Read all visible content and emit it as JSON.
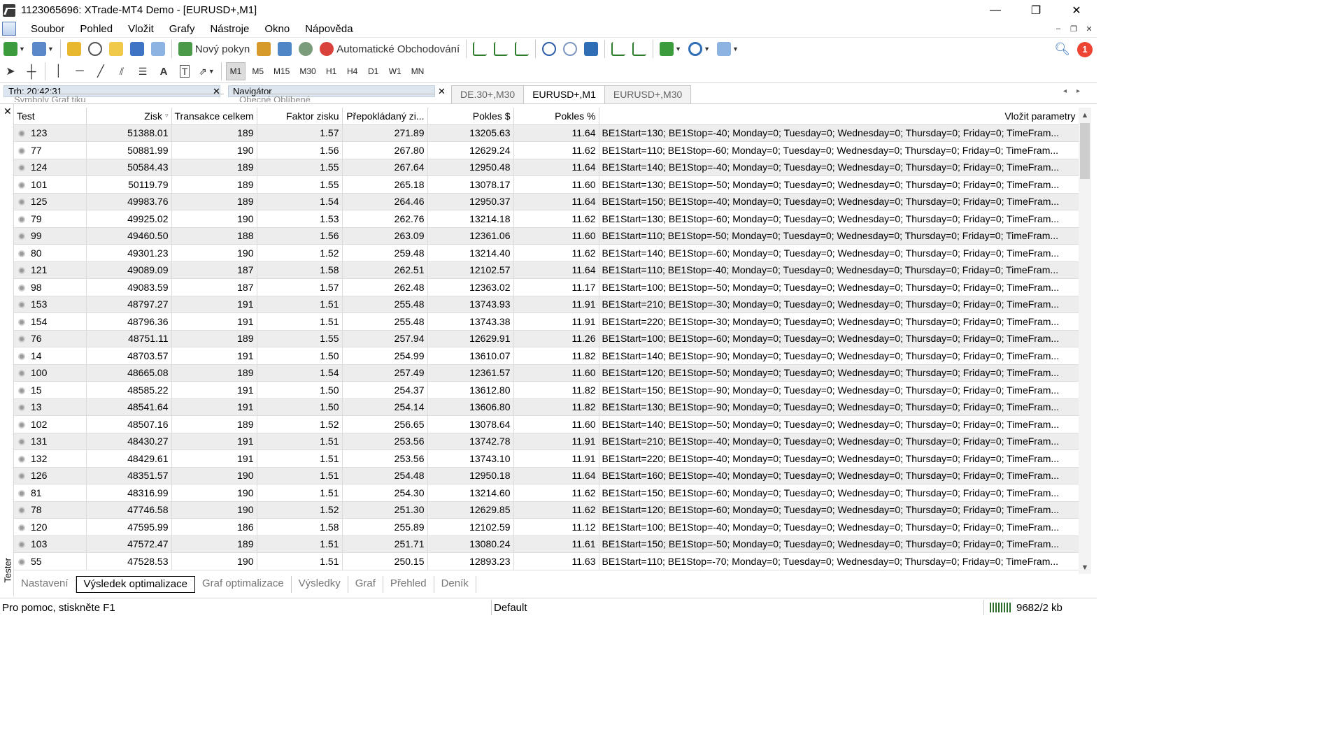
{
  "window": {
    "title": "1123065696: XTrade-MT4 Demo - [EURUSD+,M1]",
    "controls": [
      "—",
      "❐",
      "✕"
    ]
  },
  "menu": [
    "Soubor",
    "Pohled",
    "Vložit",
    "Grafy",
    "Nástroje",
    "Okno",
    "Nápověda"
  ],
  "toolbar": {
    "new_order": "Nový pokyn",
    "auto_trading": "Automatické Obchodování",
    "notification_count": "1"
  },
  "timeframes": [
    "M1",
    "M5",
    "M15",
    "M30",
    "H1",
    "H4",
    "D1",
    "W1",
    "MN"
  ],
  "active_timeframe": "M1",
  "panels": {
    "market_watch": "Trh: 20:42:31",
    "market_watch_tabs": "Symboly   Graf tiku",
    "navigator": "Navigátor",
    "navigator_tabs": "Obecné      Oblíbené"
  },
  "chart_tabs": [
    "DE.30+,M30",
    "EURUSD+,M1",
    "EURUSD+,M30"
  ],
  "active_chart_tab": "EURUSD+,M1",
  "table": {
    "columns": [
      "Test",
      "Zisk",
      "Transakce celkem",
      "Faktor zisku",
      "Přepokládaný zi...",
      "Pokles $",
      "Pokles %",
      "Vložit parametry"
    ],
    "sort_indicator": "▿",
    "param_tail": "; Monday=0; Tuesday=0; Wednesday=0; Thursday=0; Friday=0; TimeFram...",
    "rows": [
      [
        "123",
        "51388.01",
        "189",
        "1.57",
        "271.89",
        "13205.63",
        "11.64",
        "BE1Start=130; BE1Stop=-40"
      ],
      [
        "77",
        "50881.99",
        "190",
        "1.56",
        "267.80",
        "12629.24",
        "11.62",
        "BE1Start=110; BE1Stop=-60"
      ],
      [
        "124",
        "50584.43",
        "189",
        "1.55",
        "267.64",
        "12950.48",
        "11.64",
        "BE1Start=140; BE1Stop=-40"
      ],
      [
        "101",
        "50119.79",
        "189",
        "1.55",
        "265.18",
        "13078.17",
        "11.60",
        "BE1Start=130; BE1Stop=-50"
      ],
      [
        "125",
        "49983.76",
        "189",
        "1.54",
        "264.46",
        "12950.37",
        "11.64",
        "BE1Start=150; BE1Stop=-40"
      ],
      [
        "79",
        "49925.02",
        "190",
        "1.53",
        "262.76",
        "13214.18",
        "11.62",
        "BE1Start=130; BE1Stop=-60"
      ],
      [
        "99",
        "49460.50",
        "188",
        "1.56",
        "263.09",
        "12361.06",
        "11.60",
        "BE1Start=110; BE1Stop=-50"
      ],
      [
        "80",
        "49301.23",
        "190",
        "1.52",
        "259.48",
        "13214.40",
        "11.62",
        "BE1Start=140; BE1Stop=-60"
      ],
      [
        "121",
        "49089.09",
        "187",
        "1.58",
        "262.51",
        "12102.57",
        "11.64",
        "BE1Start=110; BE1Stop=-40"
      ],
      [
        "98",
        "49083.59",
        "187",
        "1.57",
        "262.48",
        "12363.02",
        "11.17",
        "BE1Start=100; BE1Stop=-50"
      ],
      [
        "153",
        "48797.27",
        "191",
        "1.51",
        "255.48",
        "13743.93",
        "11.91",
        "BE1Start=210; BE1Stop=-30"
      ],
      [
        "154",
        "48796.36",
        "191",
        "1.51",
        "255.48",
        "13743.38",
        "11.91",
        "BE1Start=220; BE1Stop=-30"
      ],
      [
        "76",
        "48751.11",
        "189",
        "1.55",
        "257.94",
        "12629.91",
        "11.26",
        "BE1Start=100; BE1Stop=-60"
      ],
      [
        "14",
        "48703.57",
        "191",
        "1.50",
        "254.99",
        "13610.07",
        "11.82",
        "BE1Start=140; BE1Stop=-90"
      ],
      [
        "100",
        "48665.08",
        "189",
        "1.54",
        "257.49",
        "12361.57",
        "11.60",
        "BE1Start=120; BE1Stop=-50"
      ],
      [
        "15",
        "48585.22",
        "191",
        "1.50",
        "254.37",
        "13612.80",
        "11.82",
        "BE1Start=150; BE1Stop=-90"
      ],
      [
        "13",
        "48541.64",
        "191",
        "1.50",
        "254.14",
        "13606.80",
        "11.82",
        "BE1Start=130; BE1Stop=-90"
      ],
      [
        "102",
        "48507.16",
        "189",
        "1.52",
        "256.65",
        "13078.64",
        "11.60",
        "BE1Start=140; BE1Stop=-50"
      ],
      [
        "131",
        "48430.27",
        "191",
        "1.51",
        "253.56",
        "13742.78",
        "11.91",
        "BE1Start=210; BE1Stop=-40"
      ],
      [
        "132",
        "48429.61",
        "191",
        "1.51",
        "253.56",
        "13743.10",
        "11.91",
        "BE1Start=220; BE1Stop=-40"
      ],
      [
        "126",
        "48351.57",
        "190",
        "1.51",
        "254.48",
        "12950.18",
        "11.64",
        "BE1Start=160; BE1Stop=-40"
      ],
      [
        "81",
        "48316.99",
        "190",
        "1.51",
        "254.30",
        "13214.60",
        "11.62",
        "BE1Start=150; BE1Stop=-60"
      ],
      [
        "78",
        "47746.58",
        "190",
        "1.52",
        "251.30",
        "12629.85",
        "11.62",
        "BE1Start=120; BE1Stop=-60"
      ],
      [
        "120",
        "47595.99",
        "186",
        "1.58",
        "255.89",
        "12102.59",
        "11.12",
        "BE1Start=100; BE1Stop=-40"
      ],
      [
        "103",
        "47572.47",
        "189",
        "1.51",
        "251.71",
        "13080.24",
        "11.61",
        "BE1Start=150; BE1Stop=-50"
      ],
      [
        "55",
        "47528.53",
        "190",
        "1.51",
        "250.15",
        "12893.23",
        "11.63",
        "BE1Start=110; BE1Stop=-70"
      ]
    ]
  },
  "tester": {
    "side_label": "Tester",
    "tabs": [
      "Nastavení",
      "Výsledek optimalizace",
      "Graf optimalizace",
      "Výsledky",
      "Graf",
      "Přehled",
      "Deník"
    ],
    "active_tab": "Výsledek optimalizace"
  },
  "status": {
    "help": "Pro pomoc, stiskněte F1",
    "profile": "Default",
    "traffic": "9682/2 kb"
  }
}
